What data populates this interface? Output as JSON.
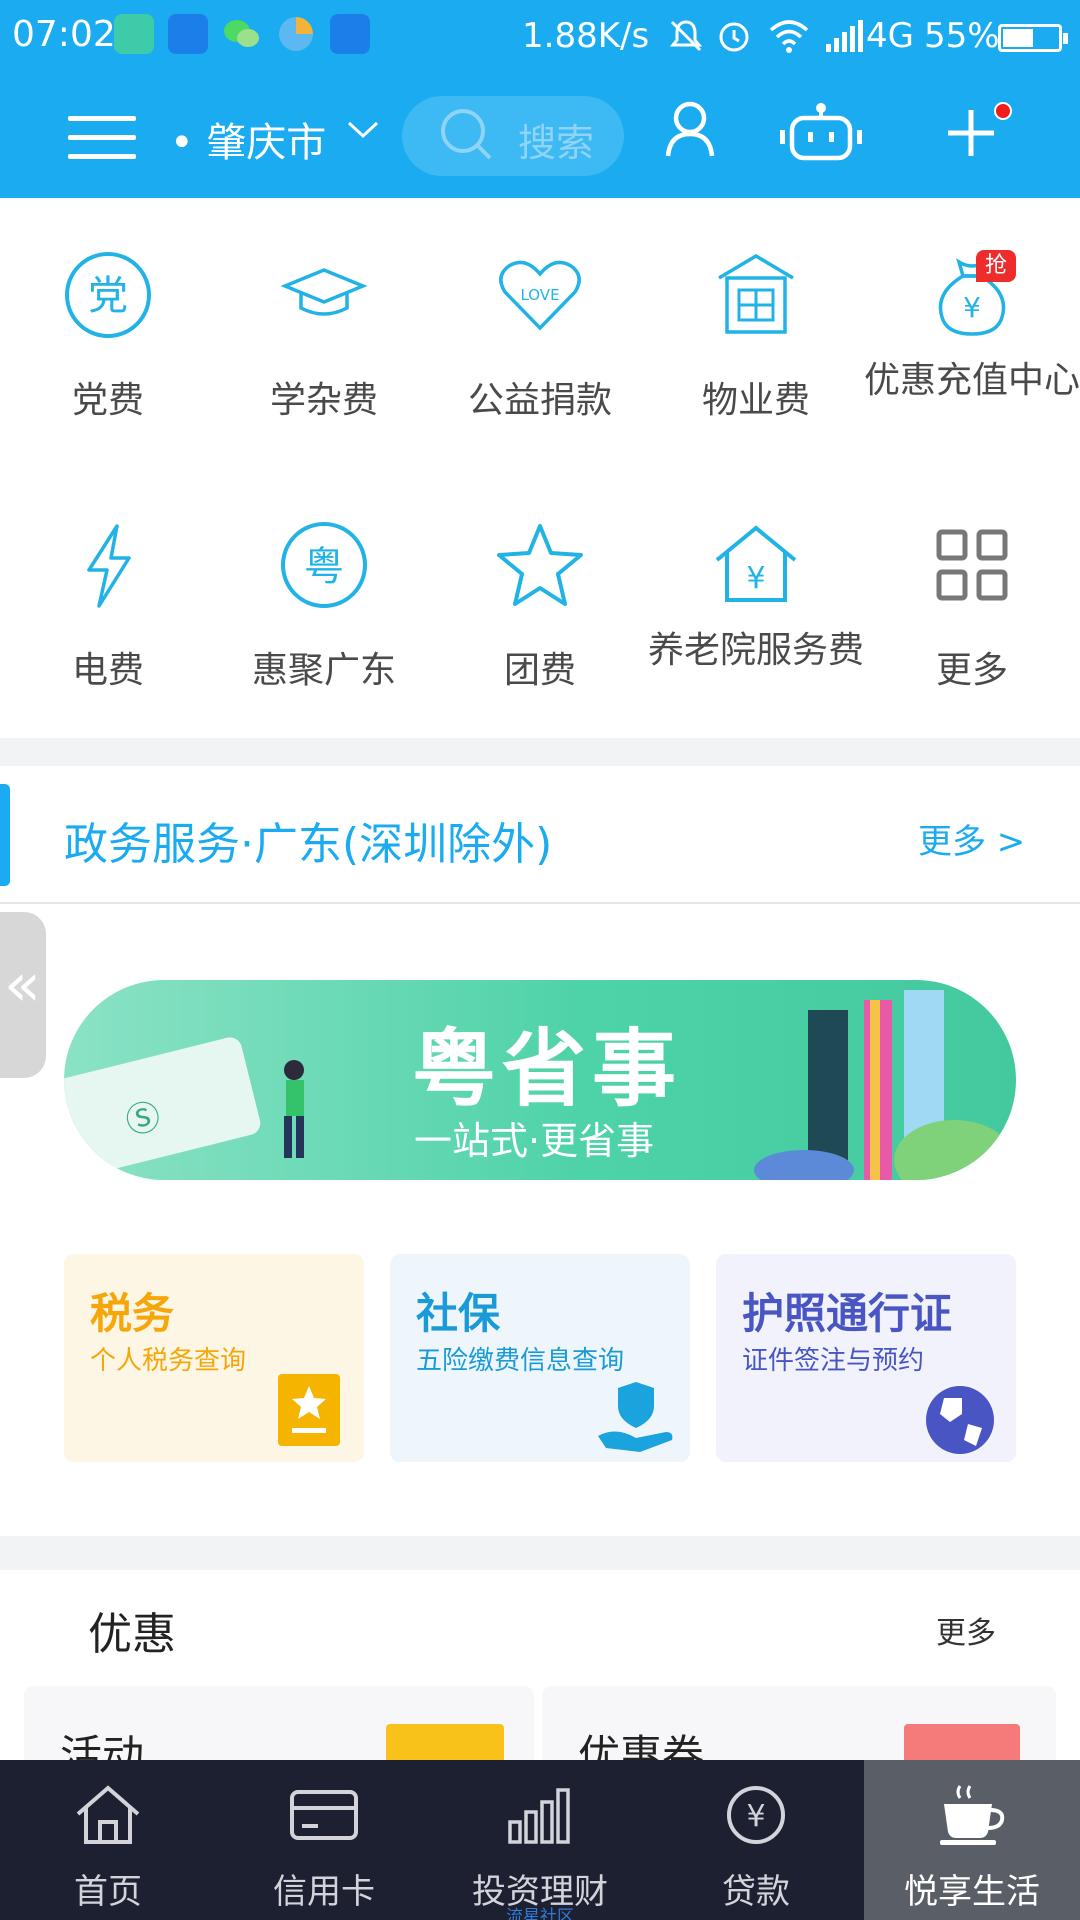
{
  "status_bar": {
    "time": "07:02",
    "speed": "1.88K/s",
    "network": "4G",
    "battery": "55%",
    "icons": [
      "screenshot-icon",
      "message-icon",
      "wechat-icon",
      "browser-icon",
      "alarm-app-icon",
      "mute-icon",
      "alarm-icon",
      "wifi-icon",
      "signal-icon",
      "battery-icon"
    ]
  },
  "header": {
    "city": "肇庆市",
    "search_placeholder": "搜索"
  },
  "services": [
    {
      "label": "党费",
      "icon": "party-fee-icon"
    },
    {
      "label": "学杂费",
      "icon": "graduation-cap-icon"
    },
    {
      "label": "公益捐款",
      "icon": "love-heart-icon"
    },
    {
      "label": "物业费",
      "icon": "building-icon"
    },
    {
      "label": "优惠充值中心",
      "icon": "money-bag-icon",
      "badge": "抢"
    },
    {
      "label": "电费",
      "icon": "lightning-icon"
    },
    {
      "label": "惠聚广东",
      "icon": "guangdong-icon"
    },
    {
      "label": "团费",
      "icon": "star-icon"
    },
    {
      "label": "养老院服务费",
      "icon": "house-yen-icon"
    },
    {
      "label": "更多",
      "icon": "grid-more-icon"
    }
  ],
  "gov": {
    "title": "政务服务·广东(深圳除外)",
    "more": "更多 >",
    "side_tab": "«",
    "banner_title": "粤省事",
    "banner_sub": "一站式·更省事"
  },
  "cards": [
    {
      "title": "税务",
      "sub": "个人税务查询",
      "color": "#f5a70a",
      "bg": "#fdf6e4"
    },
    {
      "title": "社保",
      "sub": "五险缴费信息查询",
      "color": "#1a9bd8",
      "bg": "#eef6fc"
    },
    {
      "title": "护照通行证",
      "sub": "证件签注与预约",
      "color": "#4a55c4",
      "bg": "#f1f2fb"
    }
  ],
  "youhui": {
    "title": "优惠",
    "more": "更多",
    "left": "活动",
    "right": "优惠券"
  },
  "nav": [
    {
      "label": "首页",
      "icon": "home-icon"
    },
    {
      "label": "信用卡",
      "icon": "credit-card-icon"
    },
    {
      "label": "投资理财",
      "icon": "bar-chart-icon",
      "sub": "流星社区"
    },
    {
      "label": "贷款",
      "icon": "yen-coin-icon"
    },
    {
      "label": "悦享生活",
      "icon": "coffee-cup-icon",
      "active": true
    }
  ],
  "colors": {
    "brand": "#1aabf0",
    "nav_bg": "#1d2030",
    "badge_red": "#ef2c2c"
  }
}
